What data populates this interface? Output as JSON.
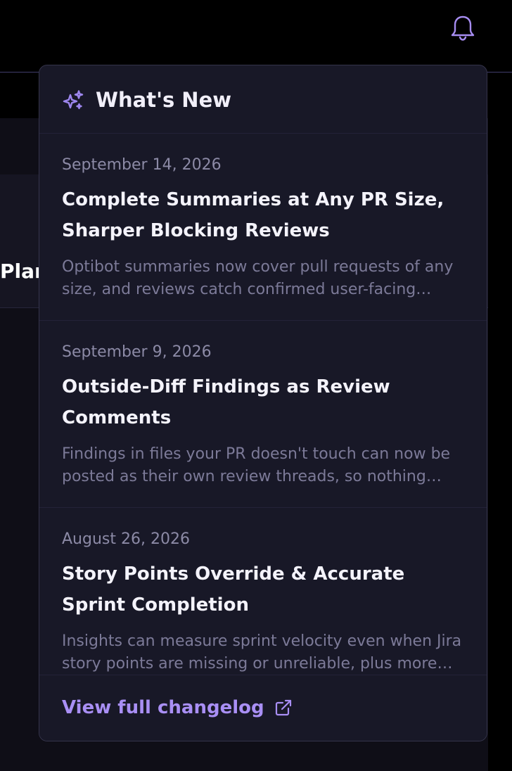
{
  "background": {
    "partial_label": "Plar"
  },
  "header": {
    "icons": [
      "bell-icon"
    ]
  },
  "whats_new": {
    "title": "What's New",
    "icon": "sparkles-icon",
    "entries": [
      {
        "date": "September 14, 2026",
        "title": "Complete Summaries at Any PR Size, Sharper Blocking Reviews",
        "description": "Optibot summaries now cover pull requests of any size, and reviews catch confirmed user-facing issues before they merge."
      },
      {
        "date": "September 9, 2026",
        "title": "Outside-Diff Findings as Review Comments",
        "description": "Findings in files your PR doesn't touch can now be posted as their own review threads, so nothing important gets buried."
      },
      {
        "date": "August 26, 2026",
        "title": "Story Points Override & Accurate Sprint Completion",
        "description": "Insights can measure sprint velocity even when Jira story points are missing or unreliable, plus more accurate sprint completion tracking."
      }
    ],
    "footer": {
      "link_label": "View full changelog",
      "link_icon": "external-link-icon"
    }
  },
  "colors": {
    "accent": "#a98ff5",
    "panel_bg": "#181827",
    "panel_border": "#35344b",
    "title_text": "#f4f3fb",
    "muted_text": "#7c7a98"
  }
}
